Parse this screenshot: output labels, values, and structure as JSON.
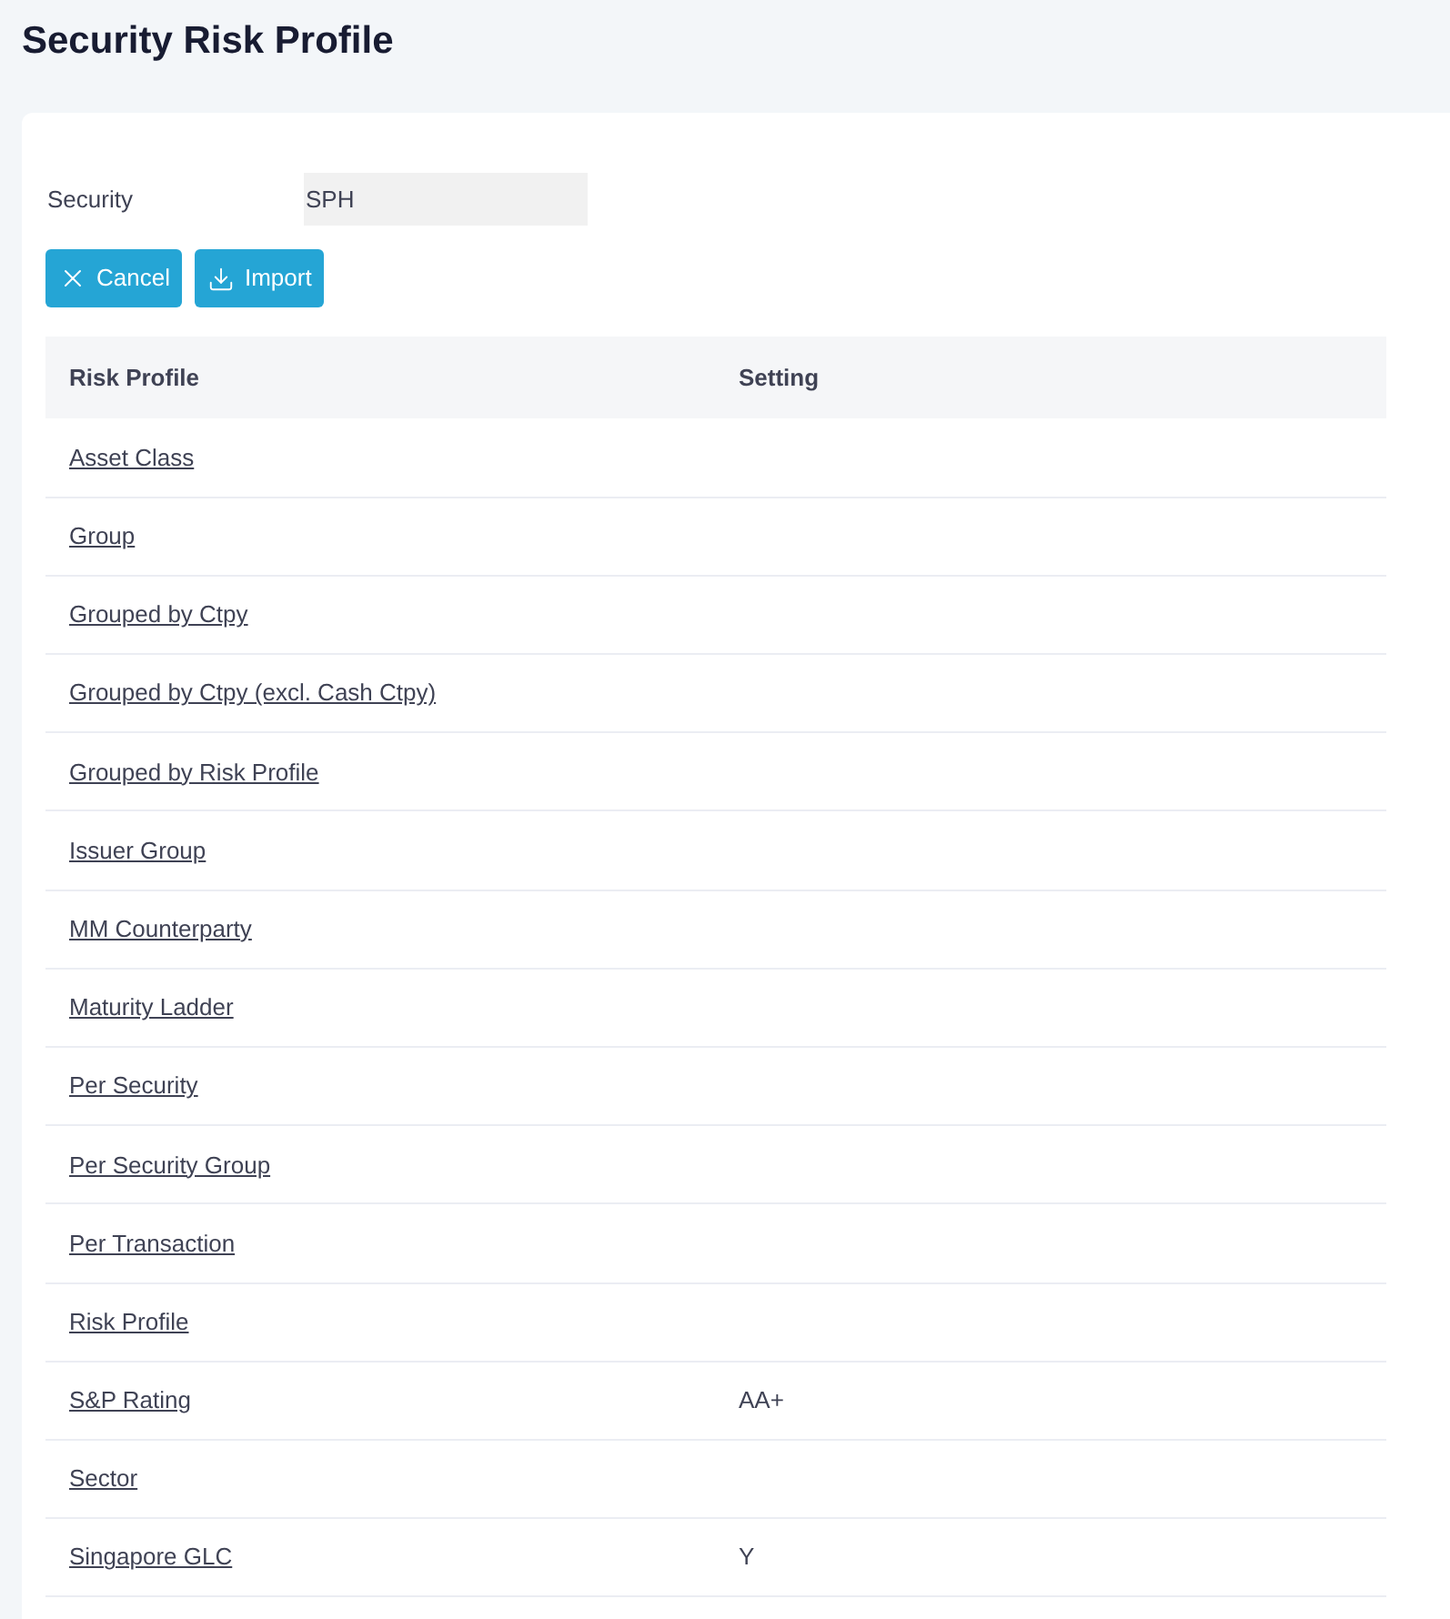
{
  "page_title": "Security Risk Profile",
  "security_field": {
    "label": "Security",
    "value": "SPH"
  },
  "buttons": [
    {
      "kind": "cancel",
      "label": "Cancel"
    },
    {
      "kind": "import",
      "label": "Import"
    }
  ],
  "table": {
    "columns": [
      "Risk Profile",
      "Setting"
    ],
    "rows": [
      {
        "profile": "Asset Class",
        "setting": ""
      },
      {
        "profile": "Group",
        "setting": ""
      },
      {
        "profile": "Grouped by Ctpy",
        "setting": ""
      },
      {
        "profile": "Grouped by Ctpy (excl. Cash Ctpy)",
        "setting": ""
      },
      {
        "profile": "Grouped by Risk Profile",
        "setting": ""
      },
      {
        "profile": "Issuer Group",
        "setting": ""
      },
      {
        "profile": "MM Counterparty",
        "setting": ""
      },
      {
        "profile": "Maturity Ladder",
        "setting": ""
      },
      {
        "profile": "Per Security",
        "setting": ""
      },
      {
        "profile": "Per Security Group",
        "setting": ""
      },
      {
        "profile": "Per Transaction",
        "setting": ""
      },
      {
        "profile": "Risk Profile",
        "setting": ""
      },
      {
        "profile": "S&P Rating",
        "setting": "AA+"
      },
      {
        "profile": "Sector",
        "setting": ""
      },
      {
        "profile": "Singapore GLC",
        "setting": "Y"
      }
    ]
  }
}
